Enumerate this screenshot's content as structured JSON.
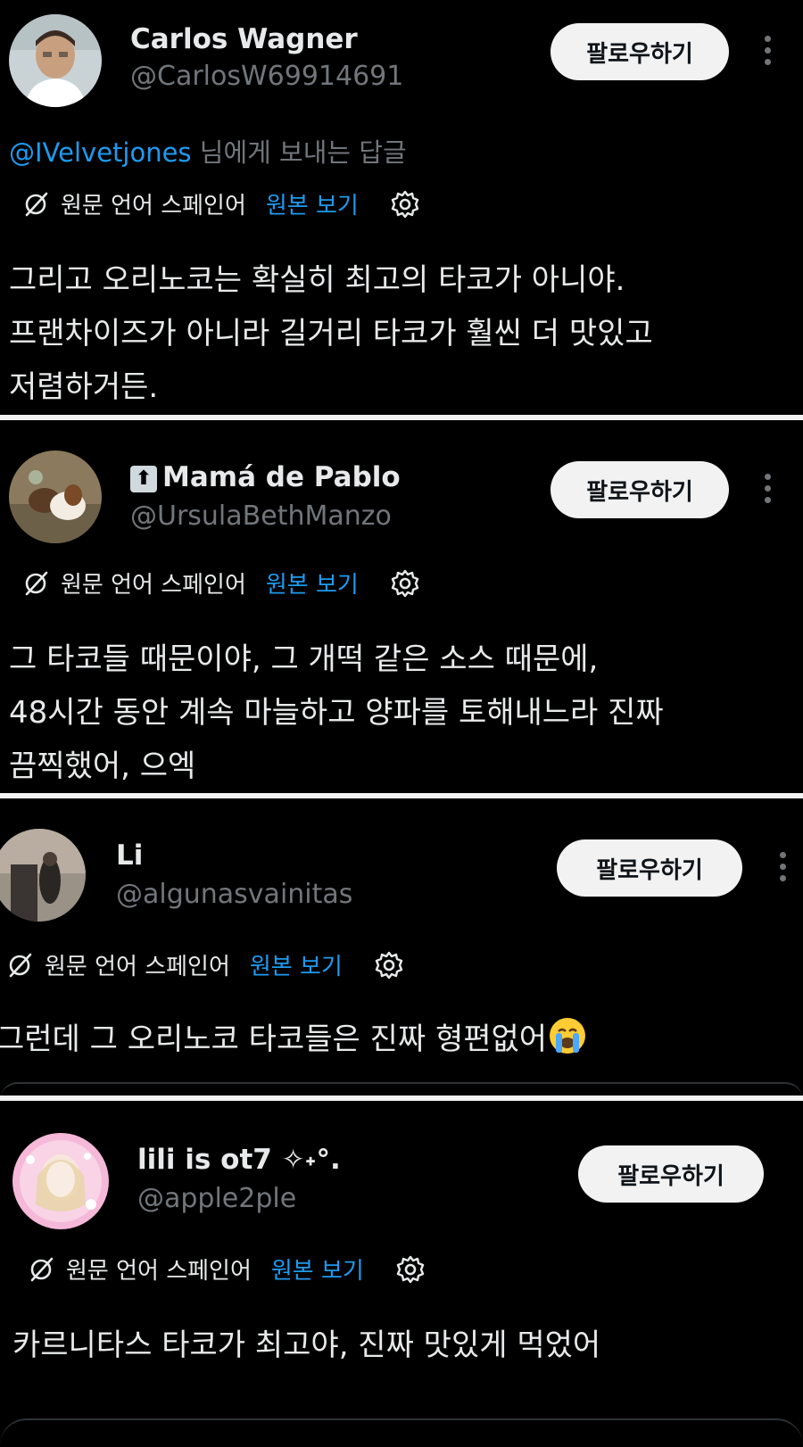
{
  "tweets": [
    {
      "name": "Carlos Wagner",
      "handle": "@CarlosW69914691",
      "follow_label": "팔로우하기",
      "replying_mention": "@IVelvetjones",
      "replying_suffix": " 님에게 보내는 답글",
      "translated_label": "원문 언어 스페인어",
      "show_original_label": "원본 보기",
      "text": "그리고 오리노코는 확실히 최고의 타코가 아니야.\n프랜차이즈가 아니라 길거리 타코가 훨씬 더 맛있고\n저렴하거든."
    },
    {
      "name_badge": "⬆",
      "name": "Mamá de Pablo",
      "handle": "@UrsulaBethManzo",
      "follow_label": "팔로우하기",
      "translated_label": "원문 언어 스페인어",
      "show_original_label": "원본 보기",
      "text": "그 타코들 때문이야, 그 개떡 같은 소스 때문에,\n48시간 동안 계속 마늘하고 양파를 토해내느라 진짜\n끔찍했어, 으엑"
    },
    {
      "name": "Li",
      "handle": "@algunasvainitas",
      "follow_label": "팔로우하기",
      "translated_label": "원문 언어 스페인어",
      "show_original_label": "원본 보기",
      "text": "그런데 그 오리노코 타코들은 진짜 형편없어",
      "emoji": "crying-face"
    },
    {
      "name": "lili is ot7 ✧˖°.",
      "handle": "@apple2ple",
      "follow_label": "팔로우하기",
      "translated_label": "원문 언어 스페인어",
      "show_original_label": "원본 보기",
      "text": "카르니타스 타코가 최고야, 진짜 맛있게 먹었어"
    }
  ],
  "colors": {
    "background": "#000000",
    "text": "#e7e9ea",
    "secondary": "#71767b",
    "link": "#1d9bf0",
    "button_bg": "#f2f2f2",
    "divider": "#f2f2f2"
  }
}
